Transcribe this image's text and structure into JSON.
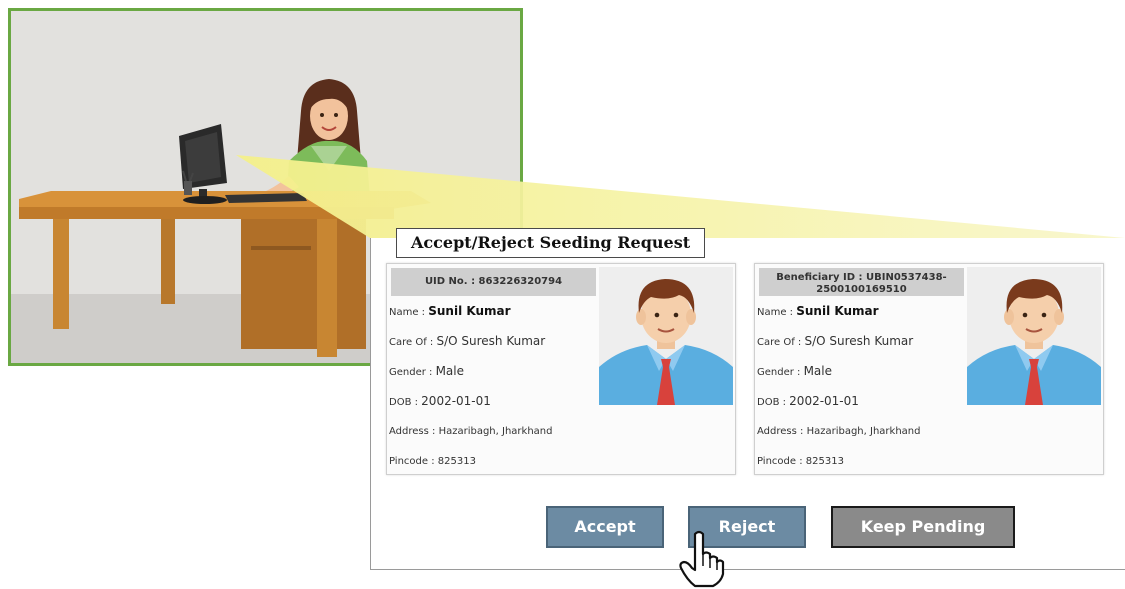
{
  "dialog": {
    "title": "Accept/Reject Seeding Request"
  },
  "uid_card": {
    "header": "UID No. : 863226320794",
    "name_label": "Name : ",
    "name_value": "Sunil Kumar",
    "care_of_label": "Care Of : ",
    "care_of_value": "S/O Suresh Kumar",
    "gender_label": "Gender : ",
    "gender_value": "Male",
    "dob_label": "DOB : ",
    "dob_value": "2002-01-01",
    "address_label": "Address : ",
    "address_value": "Hazaribagh, Jharkhand",
    "pincode_label": "Pincode : ",
    "pincode_value": "825313"
  },
  "beneficiary_card": {
    "header_line1": "Beneficiary ID : UBIN0537438-",
    "header_line2": "2500100169510",
    "name_label": "Name : ",
    "name_value": "Sunil Kumar",
    "care_of_label": "Care Of : ",
    "care_of_value": "S/O Suresh Kumar",
    "gender_label": "Gender : ",
    "gender_value": "Male",
    "dob_label": "DOB : ",
    "dob_value": "2002-01-01",
    "address_label": "Address : ",
    "address_value": "Hazaribagh, Jharkhand",
    "pincode_label": "Pincode : ",
    "pincode_value": "825313"
  },
  "buttons": {
    "accept": "Accept",
    "reject": "Reject",
    "keep_pending": "Keep Pending"
  },
  "colors": {
    "scene_border": "#6aa843",
    "button_blue": "#6c8ba3",
    "button_grey": "#8a8a8a",
    "beam_yellow": "#f6f3a8"
  },
  "icons": {
    "cursor": "hand-pointer-icon"
  }
}
